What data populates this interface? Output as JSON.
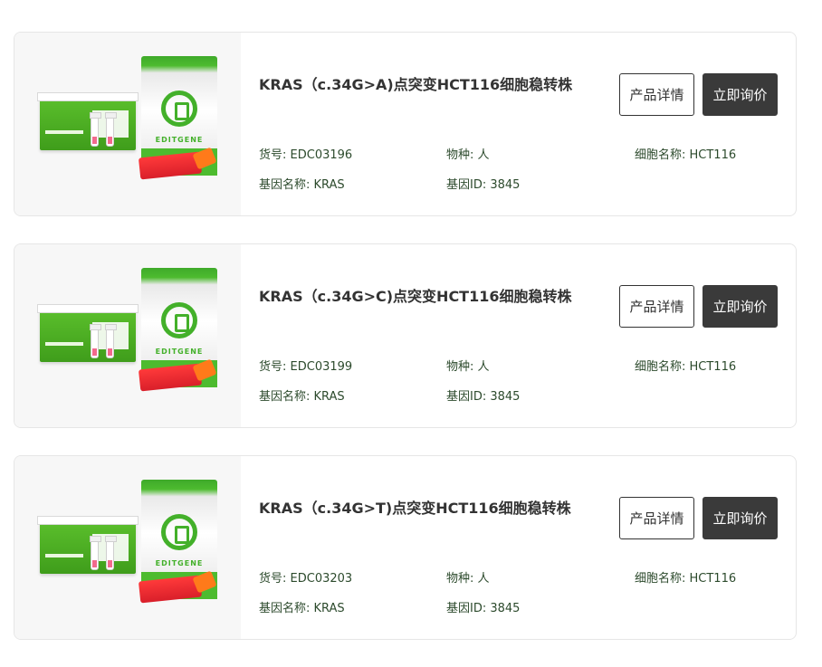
{
  "products": [
    {
      "title": "KRAS（c.34G>A)点突变HCT116细胞稳转株",
      "sku": "货号: EDC03196",
      "species": "物种: 人",
      "cell_name": "细胞名称: HCT116",
      "gene_name": "基因名称: KRAS",
      "gene_id": "基因ID: 3845",
      "detail_label": "产品详情",
      "inquire_label": "立即询价",
      "image_brand": "EDITGENE"
    },
    {
      "title": "KRAS（c.34G>C)点突变HCT116细胞稳转株",
      "sku": "货号: EDC03199",
      "species": "物种: 人",
      "cell_name": "细胞名称: HCT116",
      "gene_name": "基因名称: KRAS",
      "gene_id": "基因ID: 3845",
      "detail_label": "产品详情",
      "inquire_label": "立即询价",
      "image_brand": "EDITGENE"
    },
    {
      "title": "KRAS（c.34G>T)点突变HCT116细胞稳转株",
      "sku": "货号: EDC03203",
      "species": "物种: 人",
      "cell_name": "细胞名称: HCT116",
      "gene_name": "基因名称: KRAS",
      "gene_id": "基因ID: 3845",
      "detail_label": "产品详情",
      "inquire_label": "立即询价",
      "image_brand": "EDITGENE"
    }
  ],
  "colors": {
    "brand_green": "#43b02a",
    "button_dark": "#3a3a3a",
    "meta_text": "#2c4a2c"
  }
}
